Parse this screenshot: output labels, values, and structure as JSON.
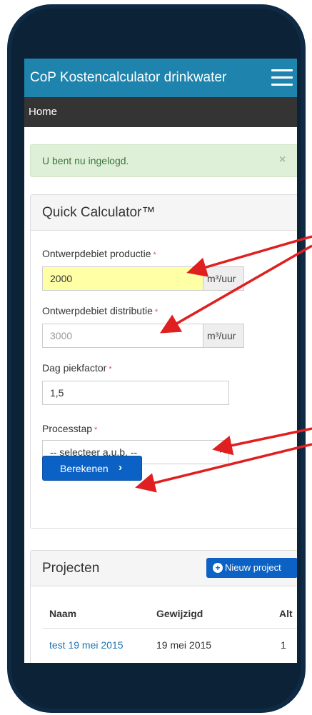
{
  "app": {
    "title": "CoP Kostencalculator drinkwater",
    "menu_icon": "hamburger-menu-icon"
  },
  "nav": {
    "home": "Home"
  },
  "alert": {
    "text": "U bent nu ingelogd.",
    "close": "×"
  },
  "calculator": {
    "title": "Quick Calculator™",
    "required_mark": "*",
    "fields": [
      {
        "label": "Ontwerpdebiet productie",
        "value": "2000",
        "unit": "m³/uur"
      },
      {
        "label": "Ontwerpdebiet distributie",
        "placeholder": "3000",
        "unit": "m³/uur"
      },
      {
        "label": "Dag piekfactor",
        "value": "1,5"
      },
      {
        "label": "Processtap",
        "selected": "-- selecteer a.u.b. --"
      }
    ],
    "submit_label": "Berekenen",
    "submit_icon": "›"
  },
  "projects": {
    "title": "Projecten",
    "new_button": "Nieuw project",
    "new_icon": "+",
    "columns": [
      "Naam",
      "Gewijzigd",
      "Alt"
    ],
    "rows": [
      [
        "test 19 mei 2015",
        "19 mei 2015",
        "1"
      ]
    ]
  },
  "colors": {
    "navbar": "#1e84ad",
    "subnav": "#343434",
    "primary_button": "#0b62c4",
    "annotation_arrow": "#e02020",
    "device_frame": "#0f2a45"
  }
}
